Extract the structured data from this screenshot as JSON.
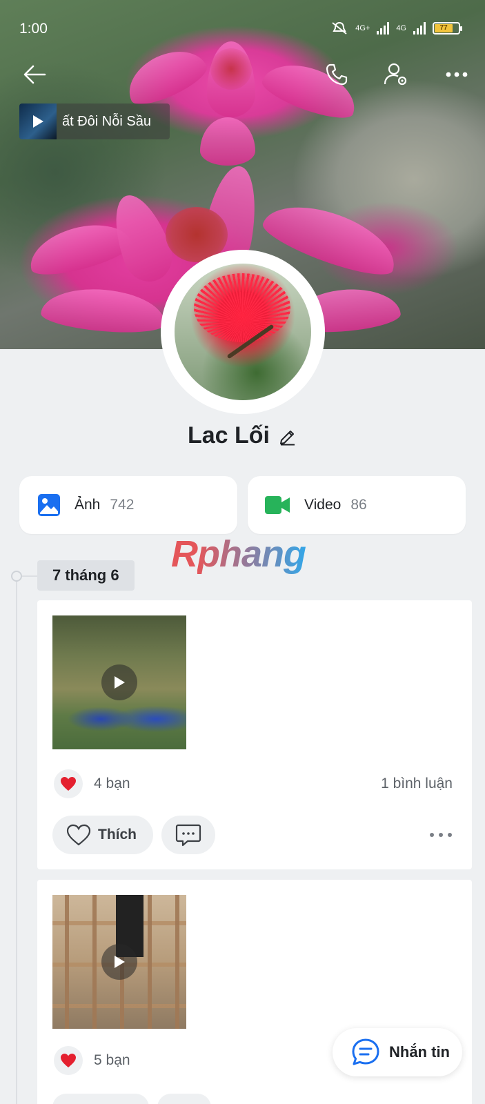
{
  "status_bar": {
    "time": "1:00",
    "network1": "4G+",
    "network2": "4G",
    "battery": "77"
  },
  "header": {
    "back_icon": "arrow-left-icon",
    "call_icon": "phone-icon",
    "settings_icon": "user-settings-icon",
    "more_icon": "more-horizontal-icon"
  },
  "music": {
    "title": "ất Đôi Nỗi Sầu"
  },
  "profile": {
    "name": "Lac Lối"
  },
  "media": [
    {
      "label": "Ảnh",
      "count": "742",
      "color": "#1a6ff0"
    },
    {
      "label": "Video",
      "count": "86",
      "color": "#27b35a"
    }
  ],
  "watermark": {
    "first": "R",
    "rest": "phang"
  },
  "timeline": {
    "date": "7 tháng 6"
  },
  "posts": [
    {
      "reactions": "4 bạn",
      "comments": "1 bình luận",
      "like_label": "Thích"
    },
    {
      "reactions": "5 bạn"
    }
  ],
  "fab": {
    "label": "Nhắn tin"
  },
  "colors": {
    "accent": "#1a6ff0",
    "heart": "#e4202f"
  }
}
